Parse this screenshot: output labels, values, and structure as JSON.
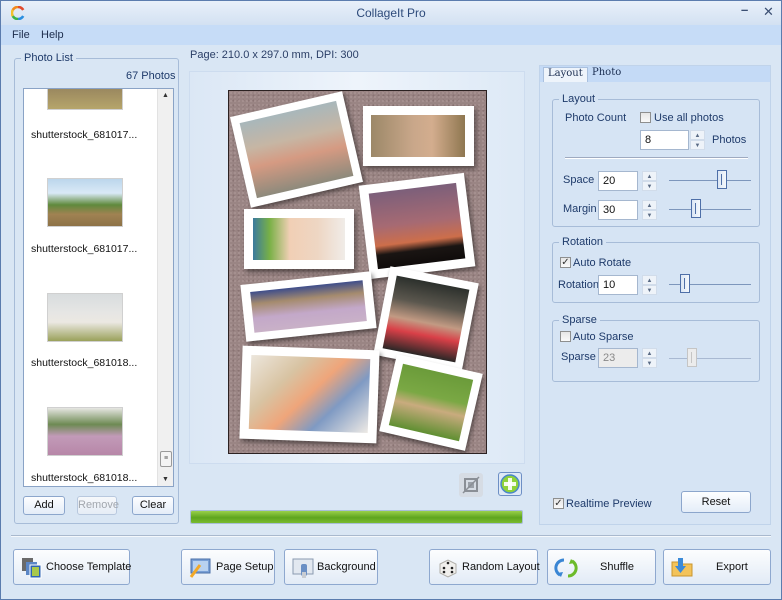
{
  "window": {
    "title": "CollageIt Pro",
    "minimize_glyph": "–",
    "close_glyph": "✕"
  },
  "menu": [
    "File",
    "Help"
  ],
  "photo_list": {
    "legend": "Photo List",
    "count_label": "67 Photos",
    "items": [
      {
        "name": "shutterstock_681017...",
        "thumb": "family-on-hay"
      },
      {
        "name": "shutterstock_681017...",
        "thumb": "family-on-hay-bale"
      },
      {
        "name": "shutterstock_681018...",
        "thumb": "father-son-toy-plane"
      },
      {
        "name": "shutterstock_681018...",
        "thumb": "mother-daughter-flowers"
      }
    ],
    "buttons": {
      "add": "Add",
      "remove": "Remove",
      "clear": "Clear"
    },
    "scroll_up_glyph": "▲",
    "scroll_down_glyph": "▼",
    "scroll_thumb_glyph": "≡"
  },
  "page_info": "Page: 210.0 x 297.0 mm, DPI: 300",
  "collage": {
    "photos": [
      "mother-kids-beach",
      "girl-reading",
      "baby-smiling",
      "silhouette-sunset",
      "girl-bed-reading",
      "elderly-couple",
      "father-toddler-floor",
      "mother-daughter-grass"
    ]
  },
  "canvas_tools": {
    "crop_icon": "crop-icon",
    "add_icon": "add-icon"
  },
  "progress": {
    "value_percent": 100
  },
  "tabs": [
    {
      "label": "Layout",
      "active": true
    },
    {
      "label": "Photo",
      "active": false
    }
  ],
  "layout_group": {
    "legend": "Layout",
    "photo_count_label": "Photo Count",
    "use_all_photos_label": "Use all photos",
    "use_all_photos_checked": false,
    "photo_count_value": "8",
    "photos_suffix": "Photos",
    "space_label": "Space",
    "space_value": "20",
    "space_slider_fraction": 0.67,
    "margin_label": "Margin",
    "margin_value": "30",
    "margin_slider_fraction": 0.3
  },
  "rotation_group": {
    "legend": "Rotation",
    "auto_rotate_label": "Auto Rotate",
    "auto_rotate_checked": true,
    "rotation_label": "Rotation",
    "rotation_value": "10",
    "rotation_slider_fraction": 0.15
  },
  "sparse_group": {
    "legend": "Sparse",
    "auto_sparse_label": "Auto Sparse",
    "auto_sparse_checked": false,
    "sparse_label": "Sparse",
    "sparse_value": "23",
    "sparse_slider_fraction": 0.25
  },
  "realtime_preview": {
    "label": "Realtime Preview",
    "checked": true
  },
  "reset_label": "Reset",
  "bottom_buttons": {
    "choose_template": "Choose Template",
    "page_setup": "Page Setup",
    "background": "Background",
    "random_layout": "Random Layout",
    "shuffle": "Shuffle",
    "export": "Export"
  },
  "check_glyph": "✓",
  "spin_up_glyph": "▲",
  "spin_down_glyph": "▼"
}
